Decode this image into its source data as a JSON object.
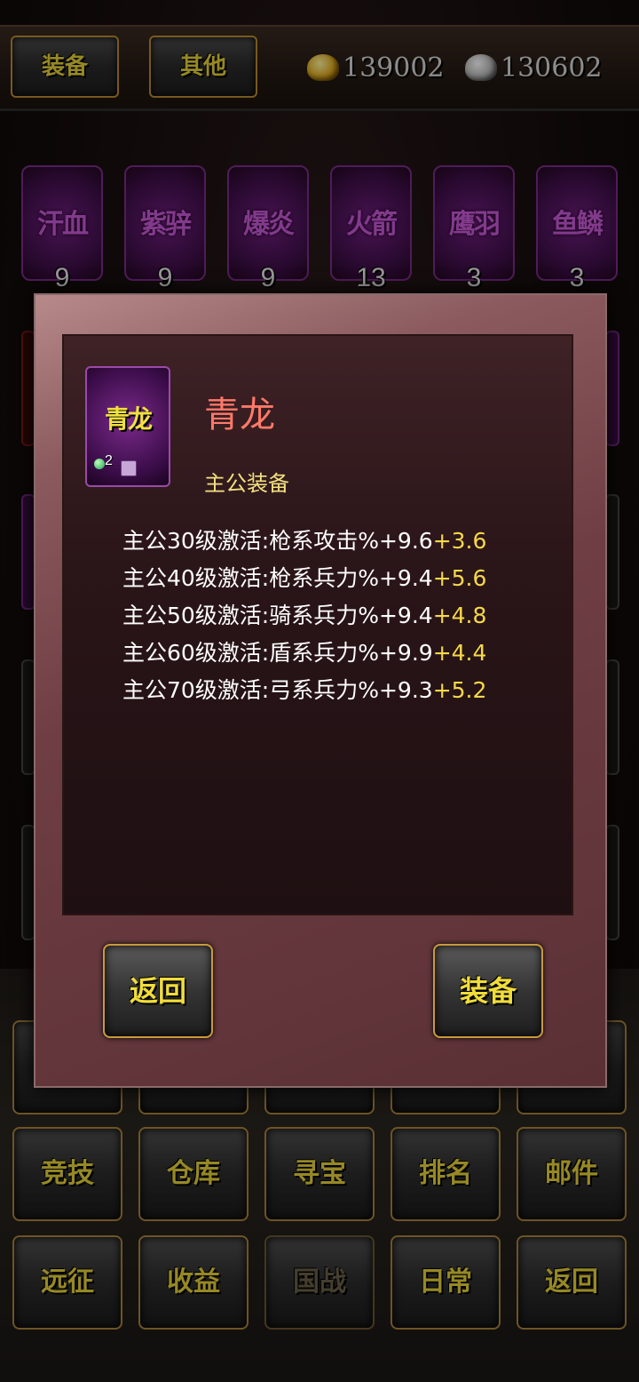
{
  "topbar": {
    "tab_equip": "装备",
    "tab_other": "其他",
    "gold_value": "139002",
    "silver_value": "130602",
    "gold_icon": "gold-ingot-icon",
    "silver_icon": "silver-ingot-icon"
  },
  "items": [
    {
      "name": "汗血",
      "count": "9"
    },
    {
      "name": "紫骍",
      "count": "9"
    },
    {
      "name": "爆炎",
      "count": "9"
    },
    {
      "name": "火箭",
      "count": "13"
    },
    {
      "name": "鹰羽",
      "count": "3"
    },
    {
      "name": "鱼鳞",
      "count": "3"
    }
  ],
  "grid": {
    "row2": [
      "竞技",
      "仓库",
      "寻宝",
      "排名",
      "邮件"
    ],
    "row3": [
      "远征",
      "收益",
      "国战",
      "日常",
      "返回"
    ]
  },
  "dialog": {
    "icon_label": "青龙",
    "icon_level": "2",
    "title": "青龙",
    "type": "主公装备",
    "attributes": [
      {
        "base": "主公30级激活:枪系攻击%+9.6",
        "bonus": "+3.6"
      },
      {
        "base": "主公40级激活:枪系兵力%+9.4",
        "bonus": "+5.6"
      },
      {
        "base": "主公50级激活:骑系兵力%+9.4",
        "bonus": "+4.8"
      },
      {
        "base": "主公60级激活:盾系兵力%+9.9",
        "bonus": "+4.4"
      },
      {
        "base": "主公70级激活:弓系兵力%+9.3",
        "bonus": "+5.2"
      }
    ],
    "back_button": "返回",
    "equip_button": "装备"
  },
  "colors": {
    "title": "#ff7a6a",
    "type": "#f2e080",
    "bonus": "#f6d84a",
    "button_text": "#e6d23a",
    "item_purple": "#6e1e7e"
  }
}
